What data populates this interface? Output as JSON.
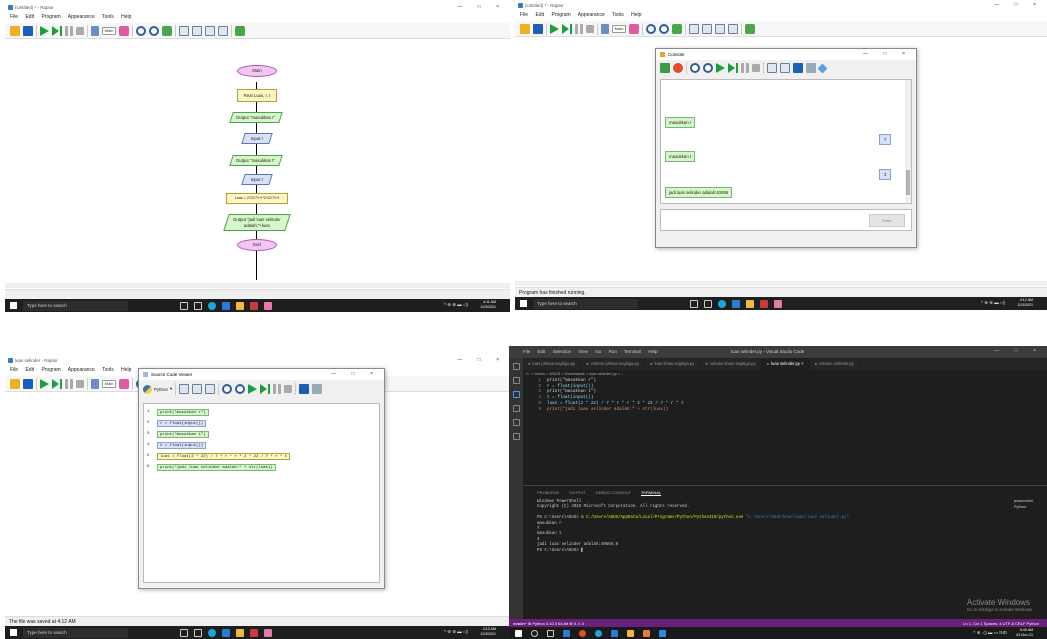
{
  "raptor": {
    "menu": [
      "File",
      "Edit",
      "Program",
      "Appearance",
      "Tools",
      "Help"
    ],
    "main_dropdown": "Main",
    "win_controls": "— □ ×",
    "lang_badge": "EN"
  },
  "q1": {
    "title": "(Untitled) * - Raptor",
    "flow": {
      "start": "Main",
      "read": "Real Luas, r, t",
      "out1": "Output \"masukkan r\"",
      "in1": "Input r",
      "out2": "Output \"masukkan t\"",
      "in2": "Input t",
      "assign": "Luas = 2*22/7*r*r*2*22/7*r*t",
      "out3": "Output \"jadi luas selinder adalah:\"+luas",
      "end": "End"
    },
    "status": "",
    "taskbar": {
      "search": "Type here to search",
      "time": "4:11 AM",
      "date": "11/3/2021"
    }
  },
  "q2": {
    "title": "(Untitled) * - Raptor",
    "console": {
      "title": "Console",
      "msg1": "masukkan r",
      "val1": "7",
      "msg2": "masukkan t",
      "val2": "3",
      "result": "jadi luas selinder adalah:40656",
      "enter_label": "Enter"
    },
    "status": "Program has finished running.",
    "taskbar": {
      "search": "Type here to search",
      "time": "4:12 AM",
      "date": "11/3/2021"
    }
  },
  "q3": {
    "title": "luas selinder - Raptor",
    "viewer": {
      "title": "Source Code Viewer",
      "language": "Python",
      "lines": [
        {
          "n": "1",
          "code": "print(\"masukkan r\")",
          "color": "#d6f5c9"
        },
        {
          "n": "2",
          "code": "r = float(input())",
          "color": "#d7e1f8"
        },
        {
          "n": "3",
          "code": "print(\"masukkan t\")",
          "color": "#d6f5c9"
        },
        {
          "n": "4",
          "code": "t = float(input())",
          "color": "#d7e1f8"
        },
        {
          "n": "5",
          "code": "luas = float(2 * 22) / 7 * r * r * 2 * 22 / 7 * r * t",
          "color": "#fdf6c2"
        },
        {
          "n": "6",
          "code": "print(\"jadi luas selinder adalah:\" + str(luas))",
          "color": "#d6f5c9"
        }
      ]
    },
    "status": "The file was saved at 4:12 AM",
    "taskbar": {
      "search": "Type here to search",
      "time": "4:13 AM",
      "date": "11/3/2021"
    }
  },
  "q4": {
    "menu": [
      "File",
      "Edit",
      "Selection",
      "View",
      "Go",
      "Run",
      "Terminal",
      "Help"
    ],
    "title": "luas selinder.py - Visual Studio Code",
    "tabs": [
      "luas prisma segitiga.py",
      "volume prisma segitiga.py",
      "luas limas segitiga.py",
      "volume limas segitiga.py",
      "luas selinder.py",
      "volume selinder.py"
    ],
    "active_tab": "luas selinder.py",
    "breadcrumb": "C: > Users > ASUS > Downloads > luas selinder.py > ...",
    "code": [
      "print(\"masukkan r\")",
      "r = float(input())",
      "print(\"masukkan t\")",
      "t = float(input())",
      "luas = float(2 * 22) / 7 * r * r * 2 * 22 / 7 * r * t",
      "print(\"jadi luas selinder adalah:\" + str(luas))"
    ],
    "panel_tabs": [
      "PROBLEMS",
      "OUTPUT",
      "DEBUG CONSOLE",
      "TERMINAL"
    ],
    "terminal": {
      "l1": "Windows PowerShell",
      "l2": "Copyright (C) 2015 Microsoft Corporation. All rights reserved.",
      "prompt": "PS C:\\Users\\ASUS> & ",
      "exe": "C:/Users/ASUS/AppData/Local/Programs/Python/Python310/python.exe",
      "file": " \"c:/Users/ASUS/Downloads/luas selinder.py\"",
      "o1": "masukkan r",
      "o2": "7",
      "o3": "masukkan t",
      "o4": "3",
      "o5": "jadi luas selinder adalah:40656.0",
      "o6": "PS C:\\Users\\ASUS> "
    },
    "shells": [
      "powershell",
      "Python"
    ],
    "activate1": "Activate Windows",
    "activate2": "Go to Settings to activate Windows.",
    "status_left": "master* ⊗ Python 3.10.0 64-bit ⊗ 0 ⚠ 0",
    "status_right": "Ln 1, Col 1  Spaces: 4  UTF-8  CRLF  Python",
    "time": "5:45 AM",
    "date": "03-Nov-21"
  }
}
